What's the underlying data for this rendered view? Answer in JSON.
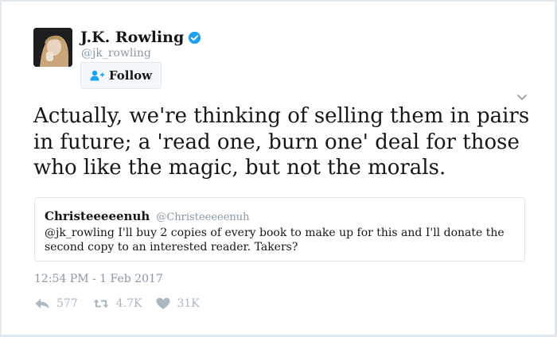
{
  "author": {
    "name": "J.K. Rowling",
    "handle": "@jk_rowling",
    "verified": true
  },
  "follow_button": {
    "label": "Follow"
  },
  "tweet": {
    "text": "Actually, we're thinking of selling them in pairs in future; a 'read one, burn one' deal for those who like the magic, but not the morals.",
    "timestamp": "12:54 PM - 1 Feb 2017"
  },
  "quoted_tweet": {
    "name": "Christeeeeenuh",
    "handle": "@Christeeeeenuh",
    "text": "@jk_rowling I'll buy 2 copies of every book to make up for this and I'll donate the second copy to an interested reader. Takers?"
  },
  "stats": {
    "replies": "577",
    "retweets": "4.7K",
    "likes": "31K"
  },
  "icons": {
    "verified": "verified-badge-icon",
    "follow": "add-user-icon",
    "more": "chevron-down-icon",
    "reply": "reply-icon",
    "retweet": "retweet-icon",
    "like": "heart-icon"
  },
  "colors": {
    "text": "#14171a",
    "muted": "#8899a6",
    "accent": "#1da1f2",
    "action": "#aab8c2",
    "border": "#e1e8ed"
  }
}
